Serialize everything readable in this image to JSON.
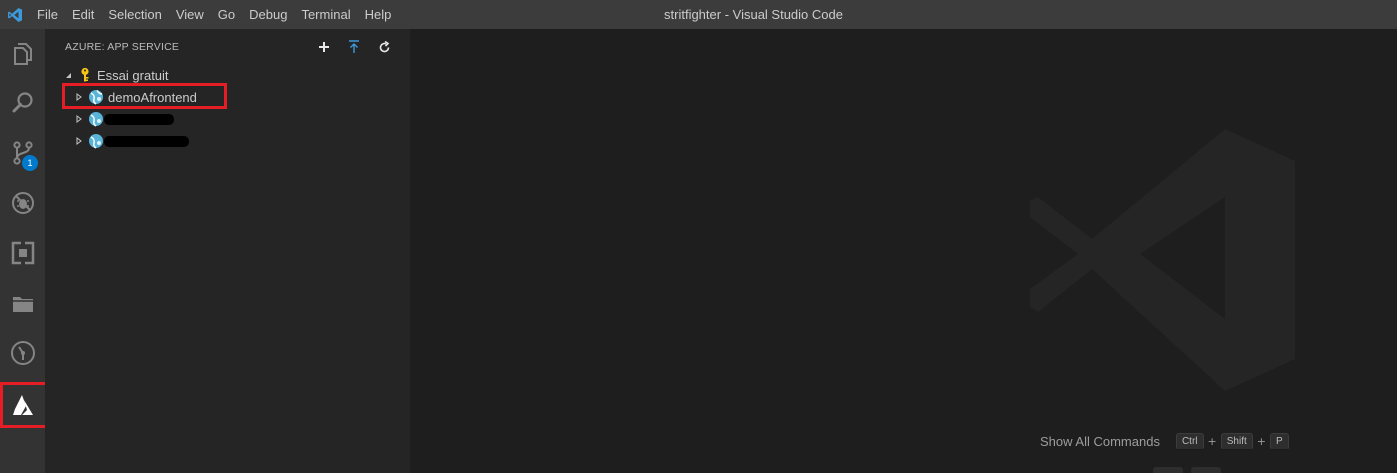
{
  "window": {
    "title": "stritfighter - Visual Studio Code"
  },
  "menu": [
    "File",
    "Edit",
    "Selection",
    "View",
    "Go",
    "Debug",
    "Terminal",
    "Help"
  ],
  "activitybar": {
    "items": [
      {
        "name": "explorer",
        "icon": "files-icon"
      },
      {
        "name": "search",
        "icon": "search-icon"
      },
      {
        "name": "source-control",
        "icon": "source-control-icon",
        "badge": "1"
      },
      {
        "name": "debug",
        "icon": "debug-icon"
      },
      {
        "name": "extensions",
        "icon": "extensions-icon"
      },
      {
        "name": "folder",
        "icon": "folder-icon"
      },
      {
        "name": "gitlens",
        "icon": "git-icon"
      },
      {
        "name": "azure",
        "icon": "azure-icon"
      }
    ]
  },
  "sidebar": {
    "title": "AZURE: APP SERVICE",
    "actions": [
      "add-icon",
      "deploy-icon",
      "refresh-icon"
    ],
    "tree": {
      "subscription": "Essai gratuit",
      "apps": [
        {
          "label": "demoAfrontend",
          "redacted": false
        },
        {
          "label": "",
          "redacted": true
        },
        {
          "label": "",
          "redacted": true
        }
      ]
    }
  },
  "editor": {
    "shortcut": {
      "label": "Show All Commands",
      "keys": [
        "Ctrl",
        "Shift",
        "P"
      ],
      "separator": "+"
    }
  },
  "colors": {
    "accent": "#007acc",
    "highlight": "#e51e25",
    "titlebar": "#3c3c3c",
    "activitybar": "#333333",
    "sidebar": "#252526",
    "editor": "#1e1e1e"
  }
}
